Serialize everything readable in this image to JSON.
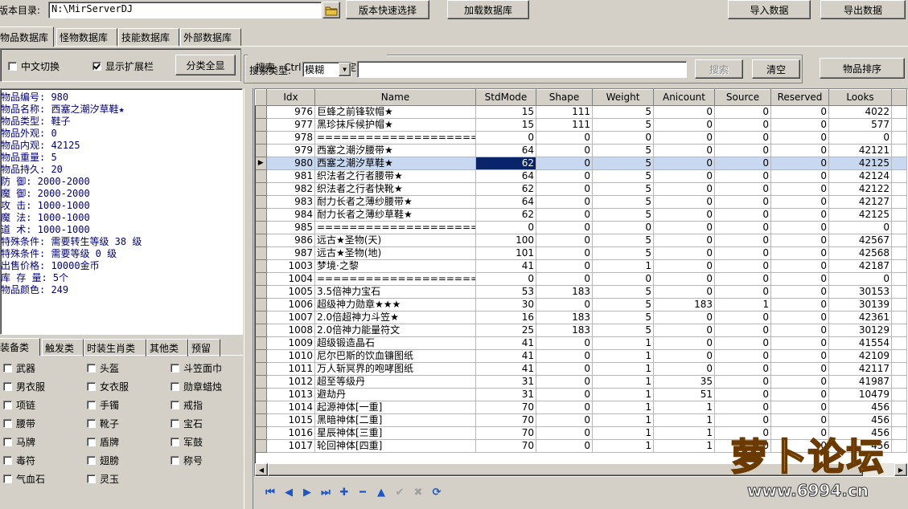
{
  "toolbar": {
    "dir_label": "版本目录:",
    "dir_value": "N:\\MirServerDJ",
    "quick_select": "版本快速选择",
    "load_db": "加载数据库",
    "import": "导入数据",
    "export": "导出数据"
  },
  "db_tabs": [
    "物品数据库",
    "怪物数据库",
    "技能数据库",
    "外部数据库"
  ],
  "options": {
    "chinese_switch": "中文切换",
    "show_ext": "显示扩展栏",
    "category_all": "分类全显"
  },
  "search": {
    "title": "搜索",
    "hint": "Ctrl+F 可打开定位搜索",
    "type_label": "搜索类型:",
    "type_value": "模糊",
    "input_value": "",
    "search_btn": "搜索",
    "clear_btn": "清空",
    "sort_btn": "物品排序"
  },
  "info_lines": [
    "物品编号: 980",
    "物品名称: 西塞之潮汐草鞋★",
    "物品类型: 鞋子",
    "物品外观: 0",
    "物品内观: 42125",
    "物品重量: 5",
    "物品持久: 20",
    "防    御: 2000-2000",
    "魔    御: 2000-2000",
    "攻    击: 1000-1000",
    "魔    法: 1000-1000",
    "道    术: 1000-1000",
    "特殊条件: 需要转生等级 38 级",
    "特殊条件: 需要等级 0 级",
    "出售价格: 10000金币",
    "库 存 量: 5个",
    "物品颜色: 249"
  ],
  "cat_tabs": [
    "装备类",
    "触发类",
    "时装生肖类",
    "其他类",
    "预留"
  ],
  "categories": [
    [
      "武器",
      "头盔",
      "斗笠面巾"
    ],
    [
      "男衣服",
      "女衣服",
      "勋章蜡烛"
    ],
    [
      "项链",
      "手镯",
      "戒指"
    ],
    [
      "腰带",
      "靴子",
      "宝石"
    ],
    [
      "马牌",
      "盾牌",
      "军鼓"
    ],
    [
      "毒符",
      "翅膀",
      "称号"
    ],
    [
      "气血石",
      "灵玉",
      ""
    ]
  ],
  "grid": {
    "columns": [
      "Idx",
      "Name",
      "StdMode",
      "Shape",
      "Weight",
      "Anicount",
      "Source",
      "Reserved",
      "Looks"
    ],
    "rows": [
      [
        "976",
        "巨蜂之前锋软帽★",
        "15",
        "111",
        "5",
        "0",
        "0",
        "0",
        "4022"
      ],
      [
        "977",
        "黑珍抹斥候护帽★",
        "15",
        "111",
        "5",
        "0",
        "0",
        "0",
        "577"
      ],
      [
        "978",
        "==============================",
        "0",
        "0",
        "0",
        "0",
        "0",
        "0",
        "0"
      ],
      [
        "979",
        "西塞之潮汐腰带★",
        "64",
        "0",
        "5",
        "0",
        "0",
        "0",
        "42121"
      ],
      [
        "980",
        "西塞之潮汐草鞋★",
        "62",
        "0",
        "5",
        "0",
        "0",
        "0",
        "42125"
      ],
      [
        "981",
        "织法者之行者腰带★",
        "64",
        "0",
        "5",
        "0",
        "0",
        "0",
        "42124"
      ],
      [
        "982",
        "织法者之行者快靴★",
        "62",
        "0",
        "5",
        "0",
        "0",
        "0",
        "42122"
      ],
      [
        "983",
        "耐力长者之薄纱腰带★",
        "64",
        "0",
        "5",
        "0",
        "0",
        "0",
        "42127"
      ],
      [
        "984",
        "耐力长者之薄纱草鞋★",
        "62",
        "0",
        "5",
        "0",
        "0",
        "0",
        "42125"
      ],
      [
        "985",
        "==============================",
        "0",
        "0",
        "0",
        "0",
        "0",
        "0",
        "0"
      ],
      [
        "986",
        "远古★圣物(天)",
        "100",
        "0",
        "5",
        "0",
        "0",
        "0",
        "42567"
      ],
      [
        "987",
        "远古★圣物(地)",
        "101",
        "0",
        "5",
        "0",
        "0",
        "0",
        "42568"
      ],
      [
        "1003",
        "梦境·之黎",
        "41",
        "0",
        "1",
        "0",
        "0",
        "0",
        "42187"
      ],
      [
        "1004",
        "==============================",
        "0",
        "0",
        "0",
        "0",
        "0",
        "0",
        "0"
      ],
      [
        "1005",
        "3.5倍神力宝石",
        "53",
        "183",
        "5",
        "0",
        "0",
        "0",
        "30153"
      ],
      [
        "1006",
        "超级神力勋章★★★",
        "30",
        "0",
        "5",
        "183",
        "1",
        "0",
        "30139"
      ],
      [
        "1007",
        "2.0倍超神力斗笠★",
        "16",
        "183",
        "5",
        "0",
        "0",
        "0",
        "42361"
      ],
      [
        "1008",
        "2.0倍神力能量符文",
        "25",
        "183",
        "5",
        "0",
        "0",
        "0",
        "30129"
      ],
      [
        "1009",
        "超级锻造晶石",
        "41",
        "0",
        "1",
        "0",
        "0",
        "0",
        "41554"
      ],
      [
        "1010",
        "尼尔巴斯的饮血镰图纸",
        "41",
        "0",
        "1",
        "0",
        "0",
        "0",
        "42109"
      ],
      [
        "1011",
        "万人斩冥界的咆哮图纸",
        "41",
        "0",
        "1",
        "0",
        "0",
        "0",
        "42117"
      ],
      [
        "1012",
        "超至等级丹",
        "31",
        "0",
        "1",
        "35",
        "0",
        "0",
        "41987"
      ],
      [
        "1013",
        "避劫丹",
        "31",
        "0",
        "1",
        "51",
        "0",
        "0",
        "10479"
      ],
      [
        "1014",
        "起源神体[一重]",
        "70",
        "0",
        "1",
        "1",
        "0",
        "0",
        "456"
      ],
      [
        "1015",
        "黑暗神体[二重]",
        "70",
        "0",
        "1",
        "1",
        "0",
        "0",
        "456"
      ],
      [
        "1016",
        "星辰神体[三重]",
        "70",
        "0",
        "1",
        "1",
        "0",
        "0",
        "456"
      ],
      [
        "1017",
        "轮回神体[四重]",
        "70",
        "0",
        "1",
        "1",
        "0",
        "0",
        "456"
      ]
    ],
    "selected_index": 4
  },
  "watermark": {
    "brand": "萝卜论坛",
    "url": "www.6994.cn"
  },
  "colors": {
    "selection": "#0a246a",
    "info_text": "#000080",
    "nav_icon": "#1b57c8"
  }
}
